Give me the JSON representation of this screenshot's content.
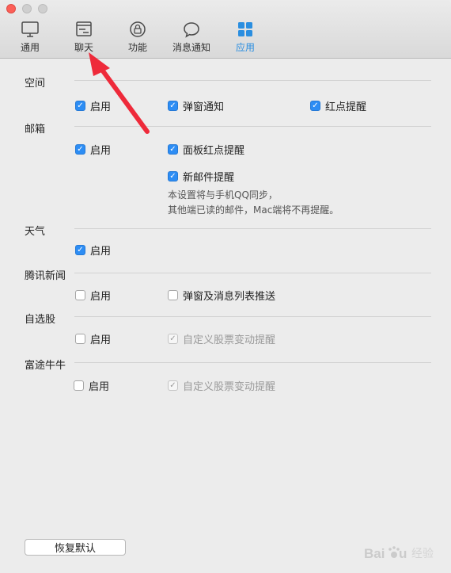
{
  "toolbar": {
    "tabs": [
      {
        "label": "通用"
      },
      {
        "label": "聊天"
      },
      {
        "label": "功能"
      },
      {
        "label": "消息通知"
      },
      {
        "label": "应用"
      }
    ],
    "active_tab": "应用",
    "accent_color": "#2a8ee0"
  },
  "sections": {
    "qzone": {
      "title": "空间",
      "enable": "启用",
      "popup": "弹窗通知",
      "reddot": "红点提醒"
    },
    "mail": {
      "title": "邮箱",
      "enable": "启用",
      "panel_reddot": "面板红点提醒",
      "new_mail": "新邮件提醒",
      "note_line1": "本设置将与手机QQ同步，",
      "note_line2": "其他端已读的邮件，Mac端将不再提醒。"
    },
    "weather": {
      "title": "天气",
      "enable": "启用"
    },
    "news": {
      "title": "腾讯新闻",
      "enable": "启用",
      "push": "弹窗及消息列表推送"
    },
    "stocks": {
      "title": "自选股",
      "enable": "启用",
      "custom_alert": "自定义股票变动提醒"
    },
    "futu": {
      "title": "富途牛牛",
      "enable": "启用",
      "custom_alert": "自定义股票变动提醒"
    }
  },
  "footer": {
    "reset_label": "恢复默认"
  },
  "watermark": {
    "text": "经验"
  }
}
